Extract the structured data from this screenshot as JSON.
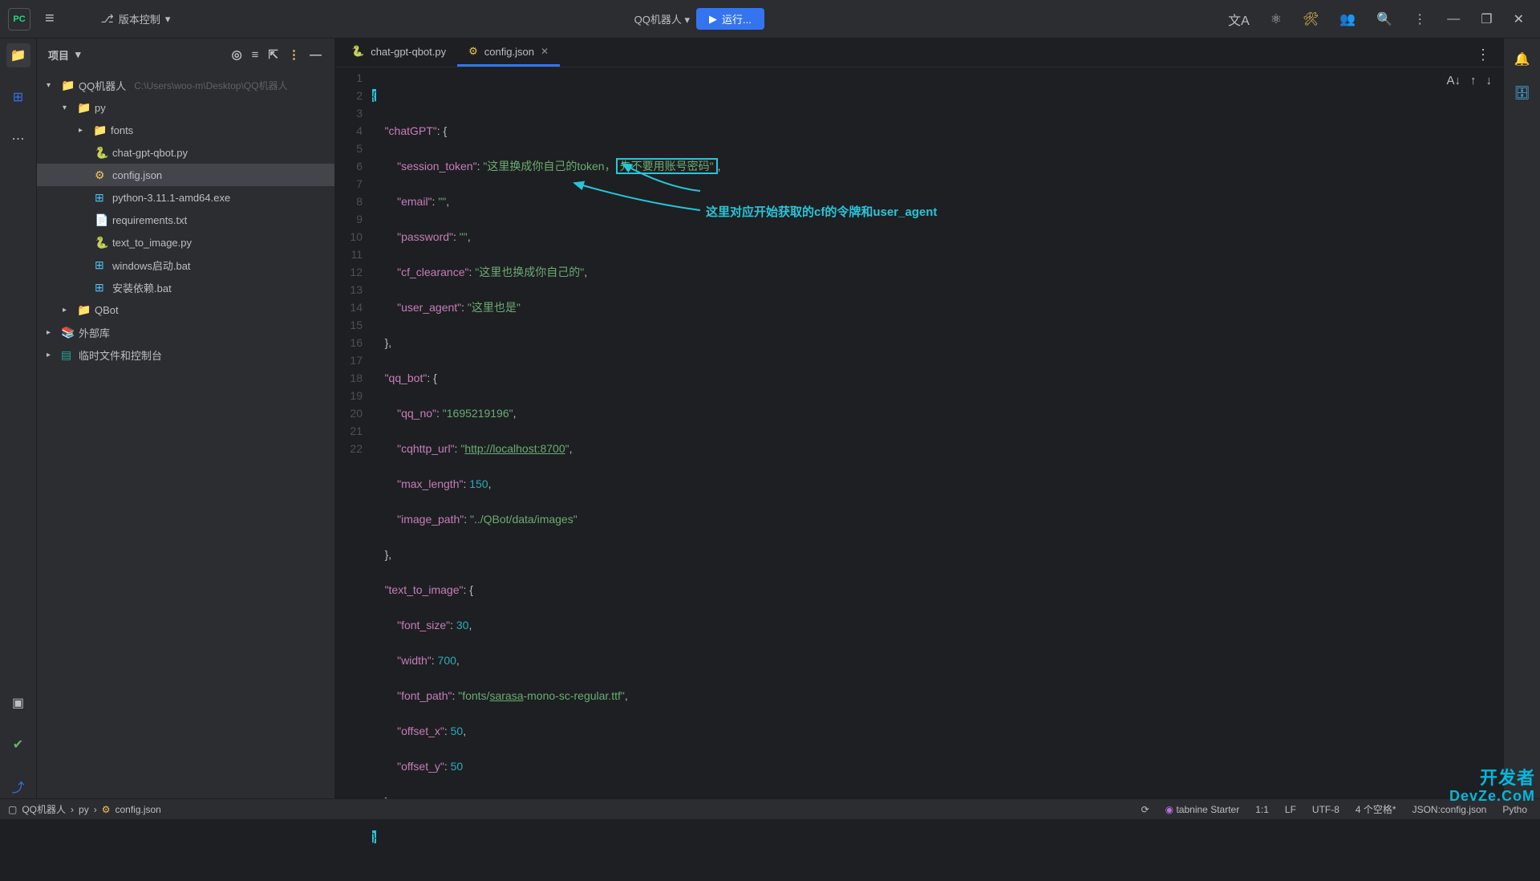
{
  "topbar": {
    "vcs_label": "版本控制",
    "project_label": "QQ机器人",
    "run_label": "运行..."
  },
  "sidebar": {
    "header": "项目",
    "root": {
      "label": "QQ机器人",
      "path": "C:\\Users\\woo-m\\Desktop\\QQ机器人"
    },
    "py_folder": "py",
    "fonts_folder": "fonts",
    "files": {
      "chat": "chat-gpt-qbot.py",
      "config": "config.json",
      "pyexe": "python-3.11.1-amd64.exe",
      "req": "requirements.txt",
      "tti": "text_to_image.py",
      "winbat": "windows启动.bat",
      "depbat": "安装依赖.bat"
    },
    "qbot_folder": "QBot",
    "ext_lib": "外部库",
    "scratch": "临时文件和控制台"
  },
  "tabs": {
    "t1": "chat-gpt-qbot.py",
    "t2": "config.json"
  },
  "code": {
    "lines": [
      "1",
      "2",
      "3",
      "4",
      "5",
      "6",
      "7",
      "8",
      "9",
      "10",
      "11",
      "12",
      "13",
      "14",
      "15",
      "16",
      "17",
      "18",
      "19",
      "20",
      "21",
      "22"
    ],
    "l1": "{",
    "k_chatgpt": "\"chatGPT\"",
    "k_session": "\"session_token\"",
    "v_session_a": "\"这里换成你自己的token，",
    "v_session_b": "先不要用账号密码\"",
    "k_email": "\"email\"",
    "v_empty": "\"\"",
    "k_password": "\"password\"",
    "k_cf": "\"cf_clearance\"",
    "v_cf": "\"这里也换成你自己的\"",
    "k_ua": "\"user_agent\"",
    "v_ua": "\"这里也是\"",
    "k_qqbot": "\"qq_bot\"",
    "k_qqno": "\"qq_no\"",
    "v_qqno": "\"1695219196\"",
    "k_cqhttp": "\"cqhttp_url\"",
    "v_cqhttp": "http://localhost:8700",
    "k_maxlen": "\"max_length\"",
    "v_150": "150",
    "k_imgpath": "\"image_path\"",
    "v_imgpath": "\"../QBot/data/images\"",
    "k_tti": "\"text_to_image\"",
    "k_fsize": "\"font_size\"",
    "v_30": "30",
    "k_width": "\"width\"",
    "v_700": "700",
    "k_fpath": "\"font_path\"",
    "v_fpath_a": "\"fonts/",
    "v_fpath_b": "sarasa",
    "v_fpath_c": "-mono-sc-regular.ttf\"",
    "k_offx": "\"offset_x\"",
    "v_50": "50",
    "k_offy": "\"offset_y\""
  },
  "annotation": "这里对应开始获取的cf的令牌和user_agent",
  "status": {
    "crumb1": "QQ机器人",
    "crumb2": "py",
    "crumb3": "config.json",
    "tabnine": "tabnine",
    "tabnine2": "Starter",
    "pos": "1:1",
    "lf": "LF",
    "enc": "UTF-8",
    "indent": "4 个空格*",
    "lang": "JSON:config.json",
    "python": "Pytho"
  },
  "watermark": {
    "l1": "开发者",
    "l2": "DevZe.CoM"
  }
}
